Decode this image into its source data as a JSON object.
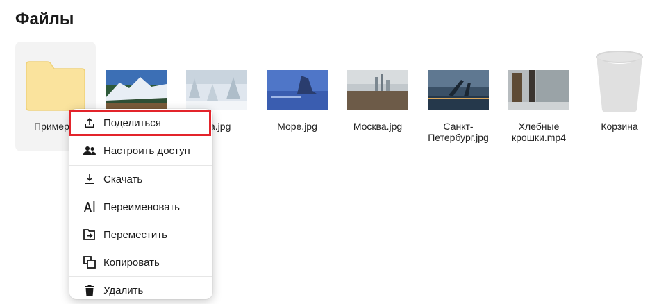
{
  "page": {
    "title": "Файлы"
  },
  "files": [
    {
      "name": "Пример",
      "icon": "folder-icon"
    },
    {
      "name": "a.jpg"
    },
    {
      "name": "Море.jpg"
    },
    {
      "name": "Москва.jpg"
    },
    {
      "name": "Санкт-Петербург.jpg"
    },
    {
      "name": "Хлебные крошки.mp4"
    },
    {
      "name": "Корзина",
      "icon": "trash-icon"
    }
  ],
  "context_menu": {
    "items": [
      {
        "label": "Поделиться",
        "icon": "share-icon"
      },
      {
        "label": "Настроить доступ",
        "icon": "people-icon"
      },
      {
        "label": "Скачать",
        "icon": "download-icon"
      },
      {
        "label": "Переименовать",
        "icon": "rename-icon"
      },
      {
        "label": "Переместить",
        "icon": "move-icon"
      },
      {
        "label": "Копировать",
        "icon": "copy-icon"
      },
      {
        "label": "Удалить",
        "icon": "delete-icon"
      }
    ]
  },
  "colors": {
    "highlight": "#e3242b",
    "folder": "#fae39d",
    "selection": "#f3f3f3"
  }
}
